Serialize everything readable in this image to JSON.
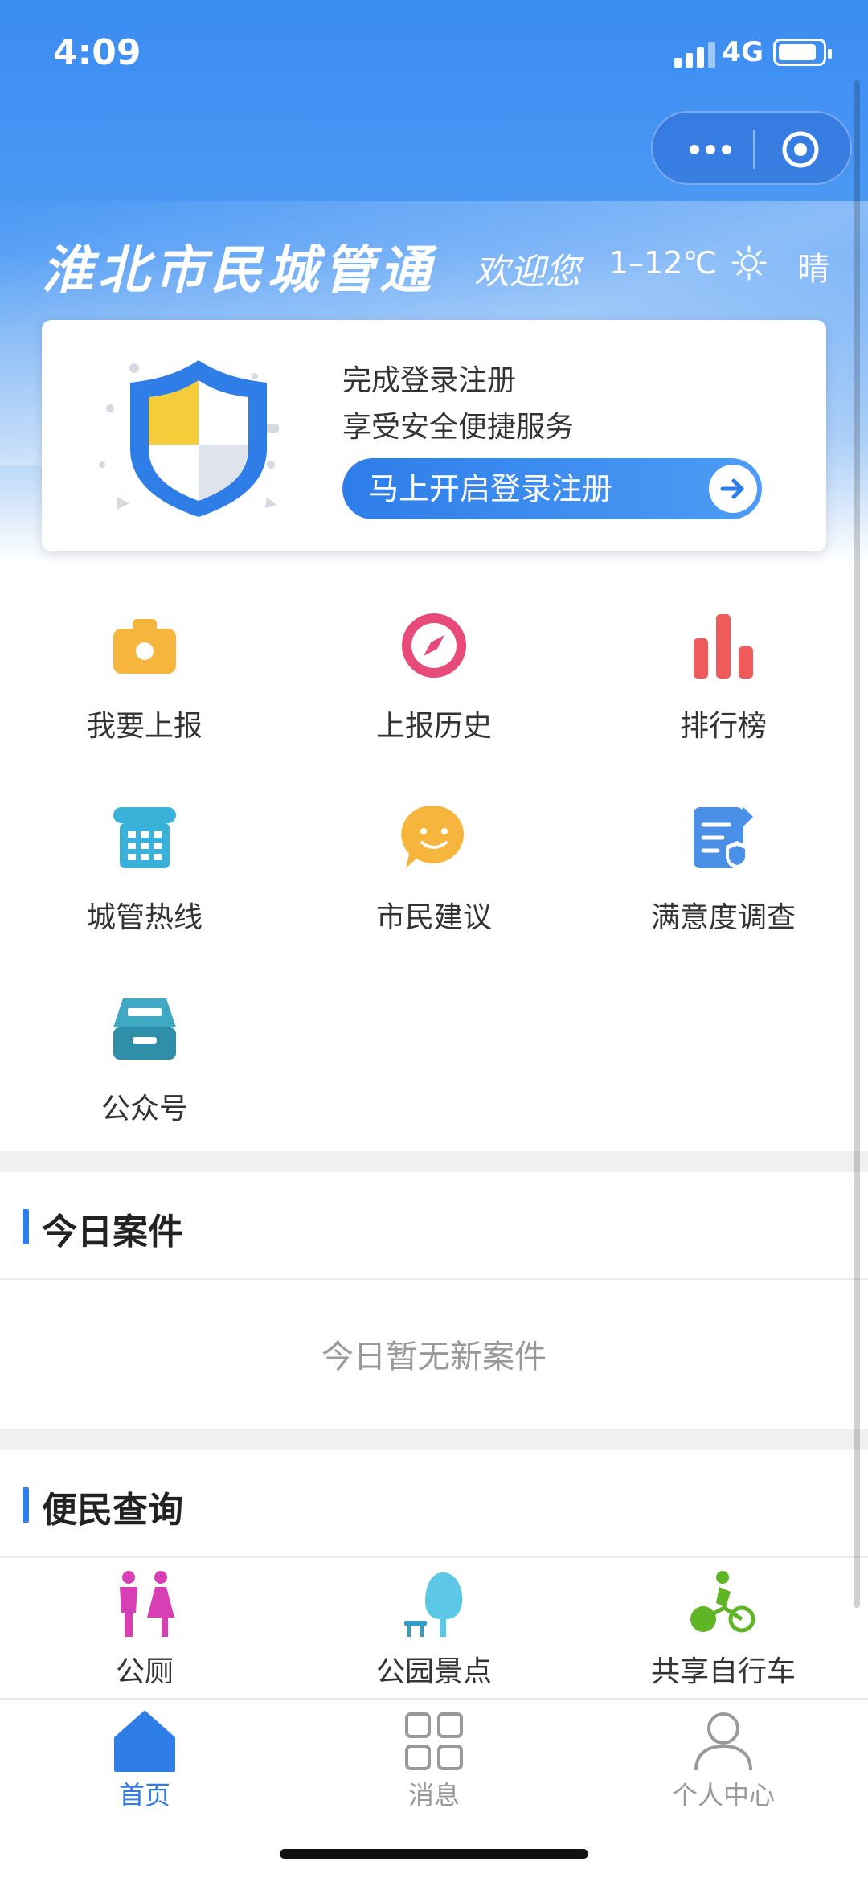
{
  "status_bar": {
    "time": "4:09",
    "network": "4G"
  },
  "header": {
    "title": "淮北市民城管通",
    "welcome": "欢迎您",
    "temperature": "1–12℃",
    "weather": "晴"
  },
  "login_card": {
    "line1": "完成登录注册",
    "line2": "享受安全便捷服务",
    "button_label": "马上开启登录注册"
  },
  "menu": [
    {
      "label": "我要上报",
      "icon": "camera-icon"
    },
    {
      "label": "上报历史",
      "icon": "compass-icon"
    },
    {
      "label": "排行榜",
      "icon": "bar-chart-icon"
    },
    {
      "label": "城管热线",
      "icon": "telephone-icon"
    },
    {
      "label": "市民建议",
      "icon": "smile-chat-icon"
    },
    {
      "label": "满意度调查",
      "icon": "survey-icon"
    },
    {
      "label": "公众号",
      "icon": "inbox-icon"
    }
  ],
  "today_cases": {
    "title": "今日案件",
    "empty_text": "今日暂无新案件"
  },
  "convenience": {
    "title": "便民查询",
    "items": [
      {
        "label": "公厕",
        "icon": "restroom-icon"
      },
      {
        "label": "公园景点",
        "icon": "park-tree-icon"
      },
      {
        "label": "共享自行车",
        "icon": "bicycle-icon"
      }
    ]
  },
  "tabbar": [
    {
      "label": "首页",
      "icon": "home-icon",
      "active": true
    },
    {
      "label": "消息",
      "icon": "grid-icon",
      "active": false
    },
    {
      "label": "个人中心",
      "icon": "user-icon",
      "active": false
    }
  ],
  "colors": {
    "primary": "#2F7EE8",
    "hero_top": "#3B8CF2",
    "inactive": "#999999"
  }
}
